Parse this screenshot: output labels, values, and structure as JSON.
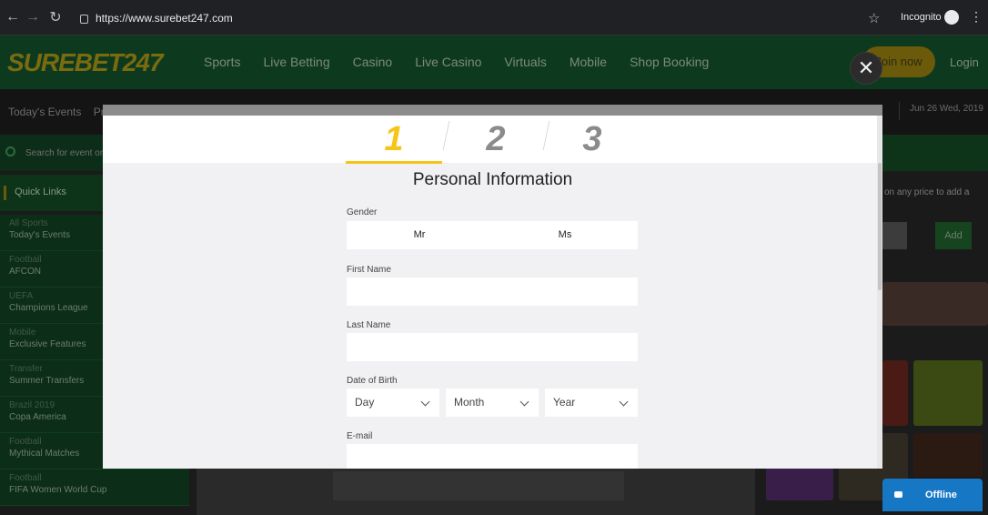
{
  "browser": {
    "url": "https://www.surebet247.com",
    "incognito_label": "Incognito"
  },
  "site": {
    "logo": "SUREBET247",
    "nav": [
      "Sports",
      "Live Betting",
      "Casino",
      "Live Casino",
      "Virtuals",
      "Mobile",
      "Shop Booking"
    ],
    "join_label": "Join now",
    "login_label": "Login",
    "today_events": "Today's Events",
    "subnav_fragment": "Pr",
    "date": "Jun 26 Wed, 2019",
    "search_placeholder": "Search for event or",
    "quick_links_title": "Quick Links",
    "quick_links": [
      {
        "category": "All Sports",
        "name": "Today's Events"
      },
      {
        "category": "Football",
        "name": "AFCON"
      },
      {
        "category": "UEFA",
        "name": "Champions League"
      },
      {
        "category": "Mobile",
        "name": "Exclusive Features"
      },
      {
        "category": "Transfer",
        "name": "Summer Transfers"
      },
      {
        "category": "Brazil 2019",
        "name": "Copa America"
      },
      {
        "category": "Football",
        "name": "Mythical Matches"
      },
      {
        "category": "Football",
        "name": "FIFA Women World Cup"
      }
    ],
    "betslip_hint": "on any price to add a",
    "add_label": "Add",
    "chat_status": "Offline"
  },
  "modal": {
    "steps": [
      "1",
      "2",
      "3"
    ],
    "active_step": 1,
    "title": "Personal Information",
    "gender_label": "Gender",
    "gender_options": [
      "Mr",
      "Ms"
    ],
    "first_name_label": "First Name",
    "first_name_value": "",
    "last_name_label": "Last Name",
    "last_name_value": "",
    "dob_label": "Date of Birth",
    "dob_day": "Day",
    "dob_month": "Month",
    "dob_year": "Year",
    "email_label": "E-mail",
    "email_value": "",
    "close_symbol": "✕"
  },
  "colors": {
    "accent": "#f5c518",
    "chat": "#1677c4"
  }
}
